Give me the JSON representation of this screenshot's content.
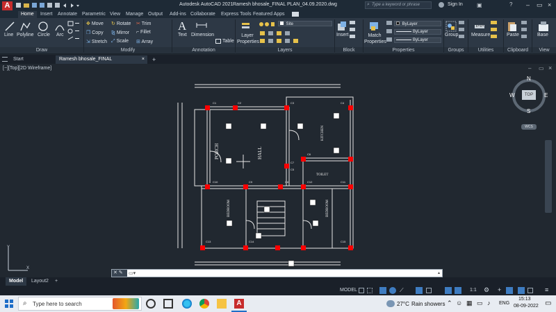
{
  "window": {
    "app_title": "Autodesk AutoCAD 2021",
    "document_title": "Ramesh bhosale_FINAL PLAN_04.09.2020.dwg",
    "search_placeholder": "Type a keyword or phrase",
    "sign_in": "Sign In"
  },
  "menu_tabs": [
    "Home",
    "Insert",
    "Annotate",
    "Parametric",
    "View",
    "Manage",
    "Output",
    "Add-ins",
    "Collaborate",
    "Express Tools",
    "Featured Apps"
  ],
  "active_tab": "Home",
  "ribbon": {
    "draw": {
      "label": "Draw",
      "tools": [
        "Line",
        "Polyline",
        "Circle",
        "Arc"
      ]
    },
    "modify": {
      "label": "Modify",
      "tools": [
        "Move",
        "Rotate",
        "Trim",
        "Copy",
        "Mirror",
        "Fillet",
        "Stretch",
        "Scale",
        "Array"
      ]
    },
    "annotation": {
      "label": "Annotation",
      "tools": [
        "Text",
        "Dimension",
        "Table"
      ]
    },
    "layers": {
      "label": "Layers",
      "tools": [
        "Layer Properties"
      ],
      "current_layer": "Site"
    },
    "block": {
      "label": "Block",
      "tools": [
        "Insert"
      ]
    },
    "properties": {
      "label": "Properties",
      "tools": [
        "Match Properties"
      ],
      "color": "ByLayer",
      "linetype": "ByLayer",
      "lineweight": "ByLayer"
    },
    "groups": {
      "label": "Groups",
      "tools": [
        "Group"
      ]
    },
    "utilities": {
      "label": "Utilities",
      "tools": [
        "Measure"
      ]
    },
    "clipboard": {
      "label": "Clipboard",
      "tools": [
        "Paste"
      ]
    },
    "view": {
      "label": "View",
      "tools": [
        "Base"
      ]
    }
  },
  "file_tabs": [
    "Start",
    "Ramesh bhosale_FINAL PLAN_04.09.2020*"
  ],
  "viewport": {
    "label": "[−][Top][2D Wireframe]",
    "viewcube": {
      "top": "TOP",
      "n": "N",
      "s": "S",
      "e": "E",
      "w": "W",
      "wcs": "WCS"
    },
    "room_labels": [
      "PORCH",
      "HALL",
      "KITCHEN",
      "BEDROOM",
      "BEDROOM",
      "TOILET"
    ],
    "column_labels": [
      "C1",
      "C2",
      "C3",
      "C4",
      "C5",
      "C6",
      "C7",
      "C8",
      "C9",
      "C10",
      "C11",
      "C12",
      "C13",
      "C14",
      "C15"
    ]
  },
  "command_line": {
    "value": ""
  },
  "layout_tabs": [
    "Model",
    "Layout2"
  ],
  "status": {
    "model": "MODEL",
    "scale": "1:1"
  },
  "taskbar": {
    "search_placeholder": "Type here to search",
    "weather_temp": "27°C",
    "weather_text": "Rain showers",
    "language": "ENG",
    "time": "15:13",
    "date": "08-09-2022"
  },
  "colors": {
    "accent_red": "#d8312a",
    "column_red": "#ff0000",
    "plan_white": "#e6e6e6",
    "ribbon_bg": "#2d3845",
    "canvas_bg": "#212830"
  }
}
